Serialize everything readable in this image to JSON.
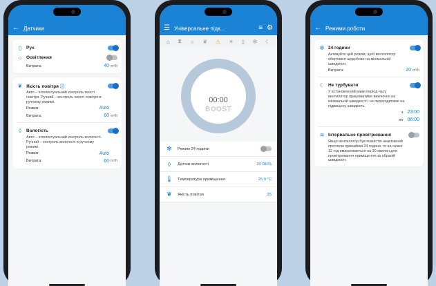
{
  "phone1": {
    "title": "Датчики",
    "motion": {
      "label": "Рух"
    },
    "light": {
      "label": "Освітлення",
      "flow_label": "Витрата:",
      "flow_value": "40",
      "unit": "m³/h"
    },
    "air": {
      "label": "Якість повітря",
      "desc": "Авто – інтелектуальний контроль якості повітря. Ручний – контроль якості повітря в ручному режимі.",
      "mode_label": "Режим:",
      "mode_value": "Auto",
      "flow_label": "Витрата:",
      "flow_value": "60",
      "unit": "m³/h"
    },
    "humidity": {
      "label": "Вологість",
      "desc": "Авто – інтелектуальний контроль вологості. Ручний – контроль вологості в ручному режимі.",
      "mode_label": "Режим:",
      "mode_value": "Auto",
      "flow_label": "Витрата:",
      "flow_value": "60",
      "unit": "m³/h"
    }
  },
  "phone2": {
    "title": "Універсальне підк...",
    "timer": "00:00",
    "boost": "BOOST",
    "stats": [
      {
        "name": "Режим 24 години",
        "value": ""
      },
      {
        "name": "Датчик вологості",
        "value": "20 RH%"
      },
      {
        "name": "Температура приміщення",
        "value": "25,0 °C"
      },
      {
        "name": "Якість повітря",
        "value": "25"
      }
    ]
  },
  "phone3": {
    "title": "Режими роботи",
    "mode24": {
      "label": "24 години",
      "desc": "Активуйте цей режим, щоб вентилятор обертався щодобово на мінімальній швидкості.",
      "flow_label": "Витрата:",
      "flow_value": "20",
      "unit": "m³/h"
    },
    "quiet": {
      "label": "Не турбувати",
      "desc": "У встановлений вами період часу вентилятор працюватиме виключно на мінімальній швидкості і не переходитиме на підвищену швидкість.",
      "from_label": "з",
      "from_value": "23:00",
      "to_label": "по",
      "to_value": "06:00"
    },
    "interval": {
      "label": "Інтервальне провітрювання",
      "desc": "Якщо вентилятор був повністю неактивний протягом принаймні 24 години, то він кожні 12 год вмикатиметься на 30 хвилин для провітрювання приміщення на обраній швидкості."
    }
  },
  "colors": {
    "accent": "#1a83d6",
    "background": "#bcd0e6"
  }
}
